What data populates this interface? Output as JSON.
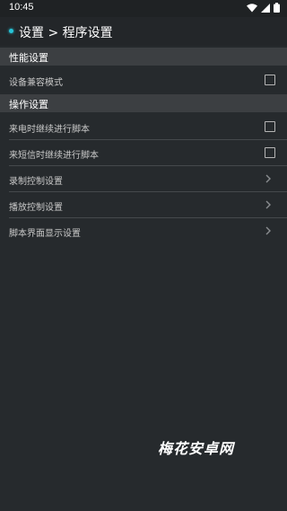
{
  "status_bar": {
    "time": "10:45",
    "icons": [
      "wifi-icon",
      "signal-icon",
      "battery-icon"
    ]
  },
  "app_bar": {
    "title": "设置 > 程序设置"
  },
  "sections": [
    {
      "header": "性能设置",
      "items": [
        {
          "label": "设备兼容模式",
          "control": "checkbox",
          "checked": false
        }
      ]
    },
    {
      "header": "操作设置",
      "items": [
        {
          "label": "来电时继续进行脚本",
          "control": "checkbox",
          "checked": false
        },
        {
          "label": "来短信时继续进行脚本",
          "control": "checkbox",
          "checked": false
        },
        {
          "label": "录制控制设置",
          "control": "chevron"
        },
        {
          "label": "播放控制设置",
          "control": "chevron"
        },
        {
          "label": "脚本界面显示设置",
          "control": "chevron"
        }
      ]
    }
  ],
  "watermark": "梅花安卓网",
  "colors": {
    "background": "#262a2d",
    "section_header": "#3c3f42",
    "accent": "#27c4d8"
  }
}
